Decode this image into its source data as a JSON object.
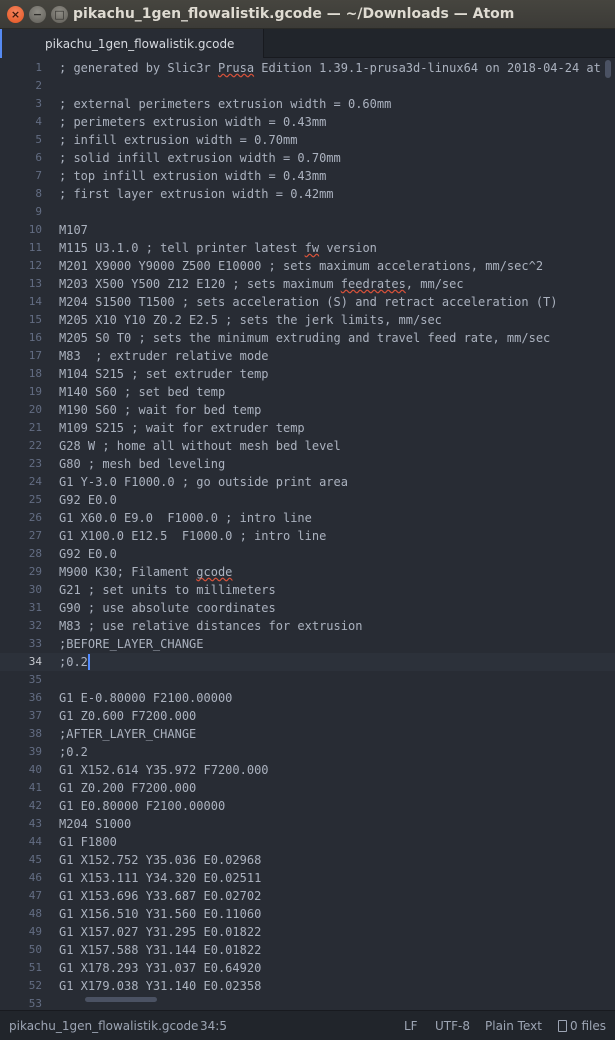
{
  "window": {
    "title": "pikachu_1gen_flowalistik.gcode — ~/Downloads — Atom",
    "buttons": {
      "close": "×",
      "minimize": "−",
      "maximize": "□"
    }
  },
  "tabs": [
    {
      "label": "pikachu_1gen_flowalistik.gcode",
      "active": true
    }
  ],
  "editor": {
    "cursor_line": 34,
    "lines": [
      {
        "n": "1",
        "text": "; generated by Slic3r Prusa Edition 1.39.1-prusa3d-linux64 on 2018-04-24 at"
      },
      {
        "n": "2",
        "text": ""
      },
      {
        "n": "3",
        "text": "; external perimeters extrusion width = 0.60mm"
      },
      {
        "n": "4",
        "text": "; perimeters extrusion width = 0.43mm"
      },
      {
        "n": "5",
        "text": "; infill extrusion width = 0.70mm"
      },
      {
        "n": "6",
        "text": "; solid infill extrusion width = 0.70mm"
      },
      {
        "n": "7",
        "text": "; top infill extrusion width = 0.43mm"
      },
      {
        "n": "8",
        "text": "; first layer extrusion width = 0.42mm"
      },
      {
        "n": "9",
        "text": ""
      },
      {
        "n": "10",
        "text": "M107"
      },
      {
        "n": "11",
        "text": "M115 U3.1.0 ; tell printer latest fw version"
      },
      {
        "n": "12",
        "text": "M201 X9000 Y9000 Z500 E10000 ; sets maximum accelerations, mm/sec^2"
      },
      {
        "n": "13",
        "text": "M203 X500 Y500 Z12 E120 ; sets maximum feedrates, mm/sec"
      },
      {
        "n": "14",
        "text": "M204 S1500 T1500 ; sets acceleration (S) and retract acceleration (T)"
      },
      {
        "n": "15",
        "text": "M205 X10 Y10 Z0.2 E2.5 ; sets the jerk limits, mm/sec"
      },
      {
        "n": "16",
        "text": "M205 S0 T0 ; sets the minimum extruding and travel feed rate, mm/sec"
      },
      {
        "n": "17",
        "text": "M83  ; extruder relative mode"
      },
      {
        "n": "18",
        "text": "M104 S215 ; set extruder temp"
      },
      {
        "n": "19",
        "text": "M140 S60 ; set bed temp"
      },
      {
        "n": "20",
        "text": "M190 S60 ; wait for bed temp"
      },
      {
        "n": "21",
        "text": "M109 S215 ; wait for extruder temp"
      },
      {
        "n": "22",
        "text": "G28 W ; home all without mesh bed level"
      },
      {
        "n": "23",
        "text": "G80 ; mesh bed leveling"
      },
      {
        "n": "24",
        "text": "G1 Y-3.0 F1000.0 ; go outside print area"
      },
      {
        "n": "25",
        "text": "G92 E0.0"
      },
      {
        "n": "26",
        "text": "G1 X60.0 E9.0  F1000.0 ; intro line"
      },
      {
        "n": "27",
        "text": "G1 X100.0 E12.5  F1000.0 ; intro line"
      },
      {
        "n": "28",
        "text": "G92 E0.0"
      },
      {
        "n": "29",
        "text": "M900 K30; Filament gcode"
      },
      {
        "n": "30",
        "text": "G21 ; set units to millimeters"
      },
      {
        "n": "31",
        "text": "G90 ; use absolute coordinates"
      },
      {
        "n": "32",
        "text": "M83 ; use relative distances for extrusion"
      },
      {
        "n": "33",
        "text": ";BEFORE_LAYER_CHANGE"
      },
      {
        "n": "34",
        "text": ";0.2"
      },
      {
        "n": "35",
        "text": ""
      },
      {
        "n": "36",
        "text": "G1 E-0.80000 F2100.00000"
      },
      {
        "n": "37",
        "text": "G1 Z0.600 F7200.000"
      },
      {
        "n": "38",
        "text": ";AFTER_LAYER_CHANGE"
      },
      {
        "n": "39",
        "text": ";0.2"
      },
      {
        "n": "40",
        "text": "G1 X152.614 Y35.972 F7200.000"
      },
      {
        "n": "41",
        "text": "G1 Z0.200 F7200.000"
      },
      {
        "n": "42",
        "text": "G1 E0.80000 F2100.00000"
      },
      {
        "n": "43",
        "text": "M204 S1000"
      },
      {
        "n": "44",
        "text": "G1 F1800"
      },
      {
        "n": "45",
        "text": "G1 X152.752 Y35.036 E0.02968"
      },
      {
        "n": "46",
        "text": "G1 X153.111 Y34.320 E0.02511"
      },
      {
        "n": "47",
        "text": "G1 X153.696 Y33.687 E0.02702"
      },
      {
        "n": "48",
        "text": "G1 X156.510 Y31.560 E0.11060"
      },
      {
        "n": "49",
        "text": "G1 X157.027 Y31.295 E0.01822"
      },
      {
        "n": "50",
        "text": "G1 X157.588 Y31.144 E0.01822"
      },
      {
        "n": "51",
        "text": "G1 X178.293 Y31.037 E0.64920"
      },
      {
        "n": "52",
        "text": "G1 X179.038 Y31.140 E0.02358"
      },
      {
        "n": "53",
        "text": ""
      }
    ]
  },
  "status": {
    "file": "pikachu_1gen_flowalistik.gcode",
    "position": "34:5",
    "line_ending": "LF",
    "encoding": "UTF-8",
    "grammar": "Plain Text",
    "git_files": "0 files"
  },
  "colors": {
    "editor_bg": "#282c34",
    "text": "#abb2bf",
    "gutter_text": "#636d83",
    "accent": "#568af2",
    "spell_underline": "#d6513a"
  }
}
